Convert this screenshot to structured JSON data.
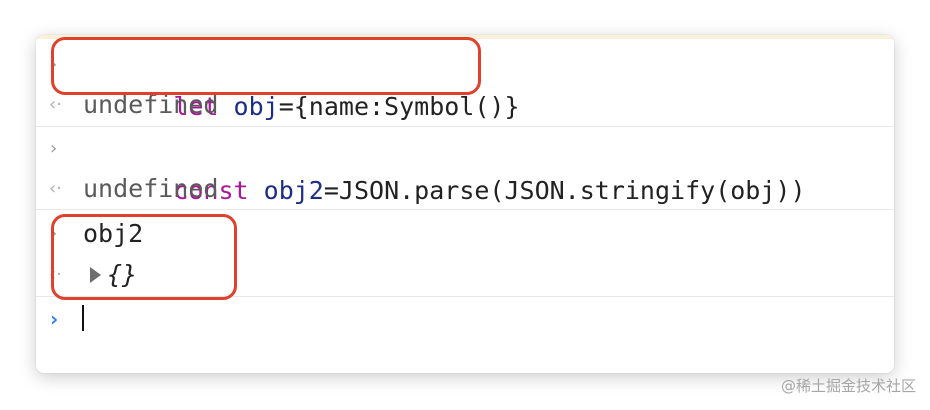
{
  "console": {
    "entries": [
      {
        "input": {
          "kw": "let",
          "var": "obj",
          "rest": "={name:Symbol()}"
        },
        "output": "undefined"
      },
      {
        "input": {
          "kw": "const",
          "var": "obj2",
          "rest": "=JSON.parse(JSON.stringify(obj))"
        },
        "output": "undefined"
      },
      {
        "input": {
          "text": "obj2"
        },
        "output": "{}"
      }
    ],
    "prompt_glyph": "›",
    "return_glyph": "‹·",
    "active_prompt_glyph": "›"
  },
  "colors": {
    "keyword": "#a8179b",
    "variable": "#1c2e86",
    "highlight_border": "#e0412d",
    "active_prompt": "#3a7ff0"
  },
  "watermark": "@稀土掘金技术社区"
}
